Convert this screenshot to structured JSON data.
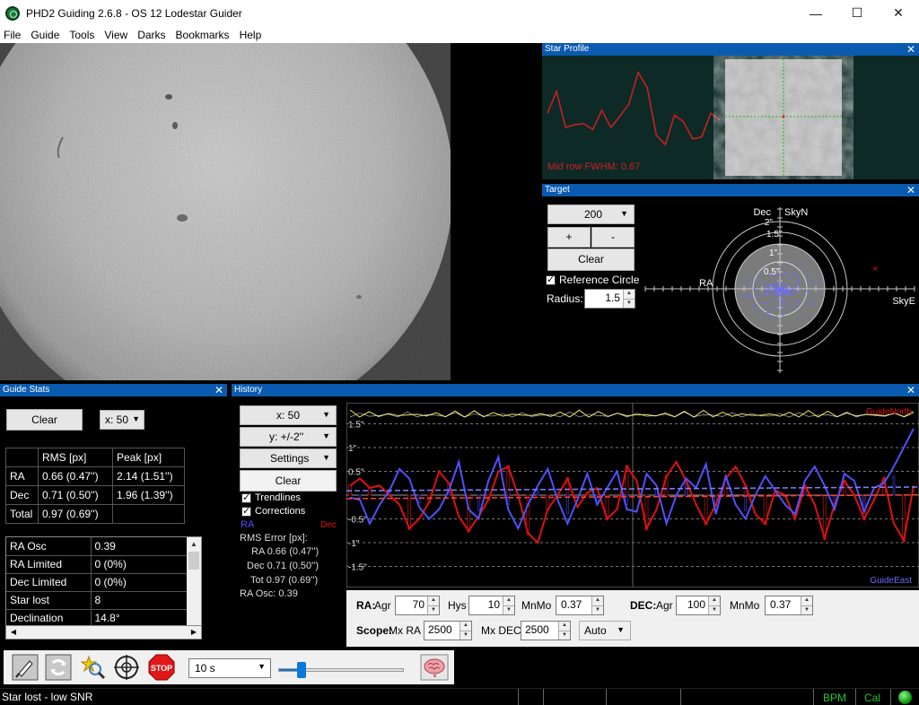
{
  "window": {
    "title": "PHD2 Guiding 2.6.8 - OS 12 Lodestar Guider",
    "minimize": "—",
    "maximize": "☐",
    "close": "✕"
  },
  "menu": [
    "File",
    "Guide",
    "Tools",
    "View",
    "Darks",
    "Bookmarks",
    "Help"
  ],
  "star_profile": {
    "title": "Star Profile",
    "fwhm_label": "Mid row FWHM: 0.67",
    "profile_values": [
      0.45,
      0.68,
      0.3,
      0.33,
      0.34,
      0.28,
      0.48,
      0.3,
      0.42,
      0.55,
      0.88,
      0.72,
      0.22,
      0.12,
      0.43,
      0.36,
      0.18,
      0.2,
      0.45,
      0.38
    ]
  },
  "target": {
    "title": "Target",
    "zoom_combo": "200",
    "plus_label": "+",
    "minus_label": "-",
    "clear_label": "Clear",
    "ref_circle_label": "Reference Circle",
    "radius_label": "Radius:",
    "radius_value": "1.5",
    "axis_dec": "Dec",
    "axis_skyn": "SkyN",
    "axis_ra": "RA",
    "axis_skye": "SkyE",
    "ring_labels": [
      "2\"",
      "1.5\"",
      "1\"",
      "0.5\""
    ]
  },
  "guide_stats": {
    "title": "Guide Stats",
    "clear_label": "Clear",
    "x_combo": "x: 50",
    "table_headers": [
      "",
      "RMS [px]",
      "Peak [px]"
    ],
    "table_rows": [
      [
        "RA",
        "0.66 (0.47'')",
        "2.14 (1.51'')"
      ],
      [
        "Dec",
        "0.71 (0.50'')",
        "1.96 (1.39'')"
      ],
      [
        "Total",
        "0.97 (0.69'')",
        ""
      ]
    ],
    "list_rows": [
      [
        "RA Osc",
        "0.39"
      ],
      [
        "RA Limited",
        "0 (0%)"
      ],
      [
        "Dec Limited",
        "0 (0%)"
      ],
      [
        "Star lost",
        "8"
      ],
      [
        "Declination",
        "14.8°"
      ]
    ]
  },
  "history": {
    "title": "History",
    "x_combo": "x:  50",
    "y_combo": "y: +/-2''",
    "settings_combo": "Settings",
    "clear_label": "Clear",
    "trendlines_label": "Trendlines",
    "corrections_label": "Corrections",
    "ra_legend": "RA",
    "dec_legend": "Dec",
    "rms_title": "RMS Error [px]:",
    "rms_ra": "RA 0.66 (0.47'')",
    "rms_dec": "Dec 0.71 (0.50'')",
    "rms_tot": "Tot 0.97 (0.69'')",
    "ra_osc": "RA Osc: 0.39",
    "y_labels": [
      "1.5\"",
      "1\"",
      "0.5\"",
      "-0.5\"",
      "-1\"",
      "-1.5\""
    ],
    "guide_north": "GuideNorth",
    "guide_east": "GuideEast",
    "colors": {
      "ra": "#5050ff",
      "dec": "#e01010",
      "snr": "#e8e860"
    },
    "ra_series": [
      -0.05,
      -0.1,
      -0.6,
      -0.2,
      0.1,
      0.55,
      0.35,
      -0.25,
      -0.5,
      -0.3,
      0.1,
      0.7,
      -0.3,
      -0.5,
      0.3,
      0.8,
      -0.3,
      -0.7,
      -0.2,
      0.2,
      0.55,
      -0.1,
      -0.6,
      -0.1,
      0.45,
      -0.2,
      0.15,
      0.5,
      -0.3,
      -0.35,
      0.45,
      0.2,
      -0.6,
      0.0,
      0.35,
      0.15,
      0.65,
      -0.4,
      0.4,
      -0.2,
      -0.5,
      0.0,
      0.4,
      0.1,
      -0.2,
      -0.4,
      0.3,
      0.6,
      0.2,
      -0.3,
      0.45,
      0.3,
      -0.35,
      0.15,
      0.25,
      0.6,
      1.0,
      1.4
    ],
    "dec_series": [
      0.2,
      0.35,
      0.15,
      0.2,
      0.0,
      -0.2,
      -0.7,
      -0.5,
      -0.15,
      0.5,
      0.25,
      -0.45,
      -0.75,
      -0.45,
      -0.1,
      0.5,
      0.6,
      0.0,
      -0.8,
      -1.0,
      -0.3,
      0.0,
      0.35,
      -0.25,
      0.05,
      0.15,
      -0.5,
      -0.3,
      0.6,
      0.3,
      -0.7,
      -0.3,
      0.4,
      0.7,
      0.3,
      -0.2,
      -0.6,
      -0.2,
      0.35,
      0.6,
      0.2,
      -0.4,
      -0.6,
      0.1,
      0.0,
      -0.5,
      0.2,
      -0.2,
      -0.9,
      -0.2,
      0.3,
      0.0,
      -0.5,
      -0.1,
      0.35,
      -0.6,
      -0.95,
      0.2
    ]
  },
  "controls": {
    "ra_label": "RA:",
    "agr_label": "Agr",
    "ra_agr": "70",
    "hys_label": "Hys",
    "ra_hys": "10",
    "mnmo_label": "MnMo",
    "ra_mnmo": "0.37",
    "dec_label": "DEC:",
    "dec_agr": "100",
    "dec_mnmo": "0.37",
    "scope_label": "Scope:",
    "mxra_label": "Mx RA",
    "mx_ra": "2500",
    "mxdec_label": "Mx DEC",
    "mx_dec": "2500",
    "dec_mode": "Auto"
  },
  "toolbar": {
    "exposure": "10 s",
    "slider_level": 0.18
  },
  "status": {
    "message": "Star lost - low SNR",
    "bpm": "BPM",
    "cal": "Cal"
  }
}
